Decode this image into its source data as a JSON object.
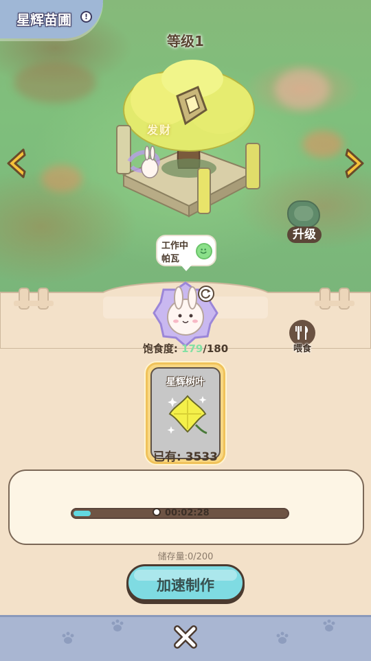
{
  "header": {
    "title": "星辉苗圃",
    "info_icon": "info-icon"
  },
  "scene": {
    "level_label": "等级1",
    "tree_text": "发财",
    "status": {
      "line1": "工作中",
      "line2": "帕瓦",
      "mood_icon": "smile-icon"
    },
    "upgrade_label": "升级"
  },
  "creature": {
    "satiety_label": "饱食度:",
    "satiety_current": "179",
    "satiety_max": "/180",
    "feed_label": "喂食"
  },
  "item": {
    "name": "星辉树叶",
    "owned": "已有: 3533"
  },
  "production": {
    "timer": "00:02:28",
    "progress": 0.08
  },
  "storage_label": "储存量:0/200",
  "speed_button_label": "加速制作",
  "colors": {
    "accent": "#7fdbe2",
    "satiety": "#84e0a4",
    "panel": "#f3e1c9",
    "bottom_bar": "#a9b6d2"
  }
}
